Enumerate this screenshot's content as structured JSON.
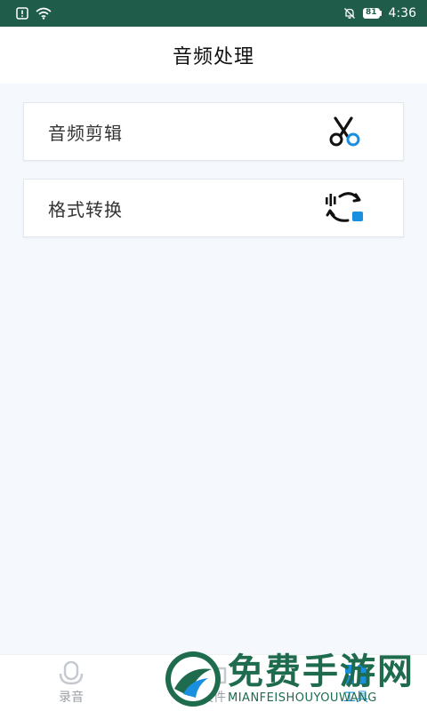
{
  "status_bar": {
    "time": "4:36",
    "battery": "81"
  },
  "header": {
    "title": "音频处理"
  },
  "cards": [
    {
      "label": "音频剪辑",
      "icon": "scissors-icon"
    },
    {
      "label": "格式转换",
      "icon": "audio-convert-icon"
    }
  ],
  "tabbar": {
    "tabs": [
      {
        "label": "录音",
        "icon": "microphone-icon",
        "active": false
      },
      {
        "label": "文件",
        "icon": "folder-icon",
        "active": false
      },
      {
        "label": "工具",
        "icon": "tools-icon",
        "active": true
      }
    ]
  },
  "watermark": {
    "cn": "免费手游网",
    "en": "MIANFEISHOUYOUWANG"
  },
  "colors": {
    "status_bar": "#1f5c49",
    "accent": "#1a8fe0",
    "background": "#f5f8fc"
  }
}
